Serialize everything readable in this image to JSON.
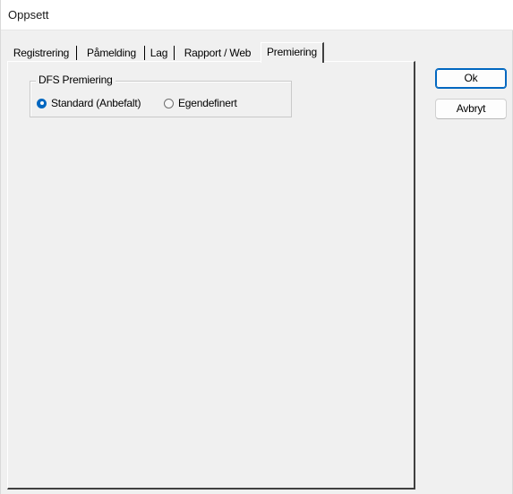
{
  "window": {
    "title": "Oppsett"
  },
  "tabs": [
    {
      "label": "Registrering",
      "selected": false
    },
    {
      "label": "Påmelding",
      "selected": false
    },
    {
      "label": "Lag",
      "selected": false
    },
    {
      "label": "Rapport / Web",
      "selected": false
    },
    {
      "label": "Premiering",
      "selected": true
    }
  ],
  "premiering": {
    "group_label": "DFS Premiering",
    "options": [
      {
        "label": "Standard (Anbefalt)",
        "checked": true
      },
      {
        "label": "Egendefinert",
        "checked": false
      }
    ]
  },
  "buttons": {
    "ok_label": "Ok",
    "cancel_label": "Avbryt"
  },
  "colors": {
    "accent": "#0067c0",
    "window_background": "#f0f0f0",
    "titlebar_background": "#ffffff"
  }
}
